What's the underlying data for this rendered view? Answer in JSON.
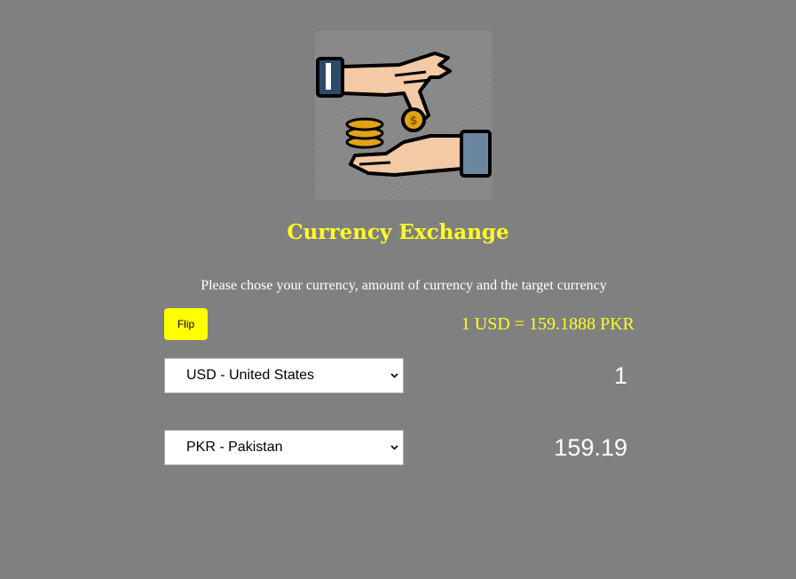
{
  "header": {
    "logo_icon": "hand-giving-coin-icon",
    "title": "Currency Exchange",
    "instructions": "Please chose your currency, amount of currency and the target currency"
  },
  "controls": {
    "flip_label": "Flip",
    "rate_text": "1 USD = 159.1888 PKR"
  },
  "from": {
    "currency": "USD - United States",
    "amount": "1"
  },
  "to": {
    "currency": "PKR - Pakistan",
    "amount": "159.19"
  },
  "colors": {
    "background": "#808080",
    "accent": "#ffff24",
    "button": "#ffff00"
  }
}
